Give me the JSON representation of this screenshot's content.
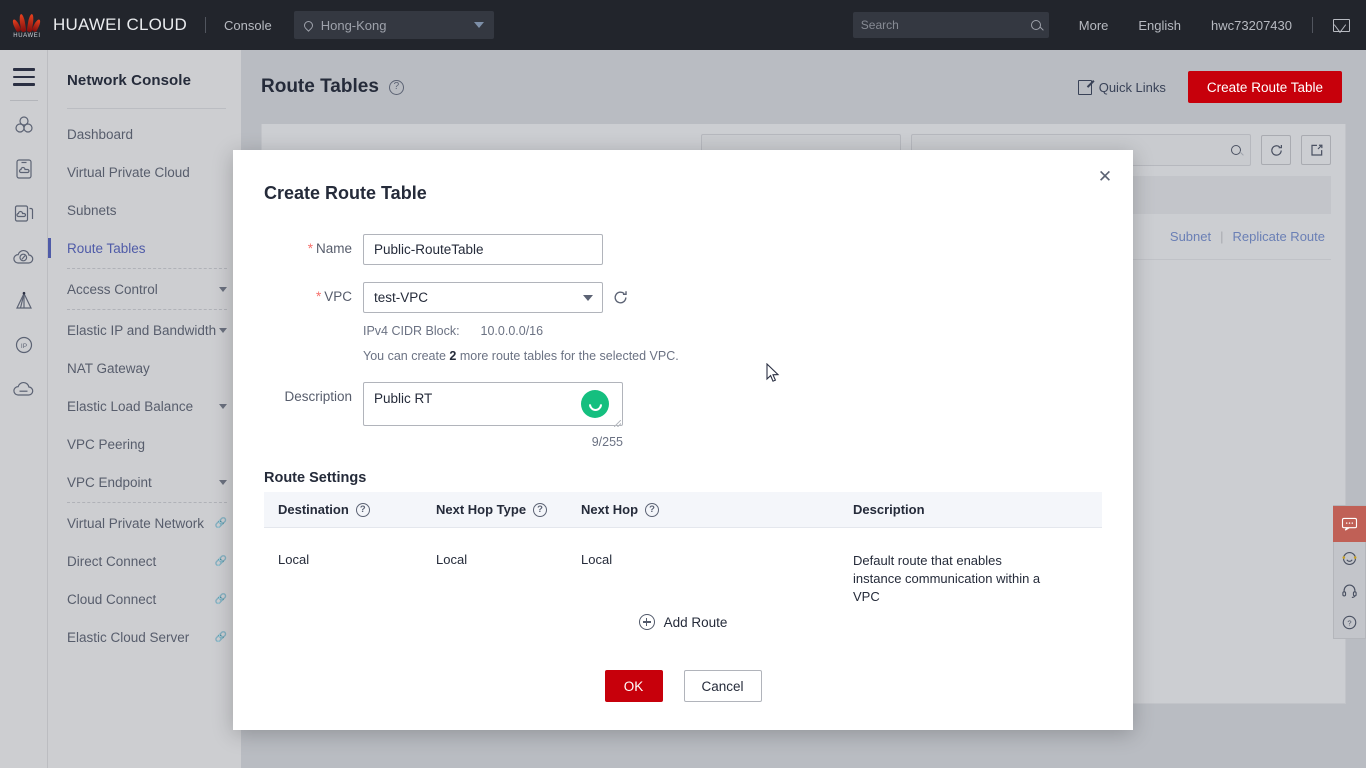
{
  "topbar": {
    "brand": "HUAWEI CLOUD",
    "brand_sub": "HUAWEI",
    "console_label": "Console",
    "region": "Hong-Kong",
    "region_icon": "location-pin-icon",
    "search_placeholder": "Search",
    "search_icon": "search-icon",
    "more_label": "More",
    "language_label": "English",
    "account_label": "hwc73207430",
    "mail_icon": "envelope-icon"
  },
  "rail": {
    "menu_icon": "hamburger-menu-icon",
    "icons": [
      "service-group-icon",
      "cloud-document-icon",
      "cloud-copy-icon",
      "cloud-speed-icon",
      "cdn-pyramid-icon",
      "elastic-ip-icon",
      "cloud-nat-icon"
    ]
  },
  "sidebar": {
    "title": "Network Console",
    "items": [
      {
        "label": "Dashboard",
        "expandable": false,
        "external": false,
        "active": false
      },
      {
        "label": "Virtual Private Cloud",
        "expandable": false,
        "external": false,
        "active": false
      },
      {
        "label": "Subnets",
        "expandable": false,
        "external": false,
        "active": false
      },
      {
        "label": "Route Tables",
        "expandable": false,
        "external": false,
        "active": true
      },
      {
        "label": "Access Control",
        "expandable": true,
        "external": false,
        "active": false
      },
      {
        "label": "Elastic IP and Bandwidth",
        "expandable": true,
        "external": false,
        "active": false
      },
      {
        "label": "NAT Gateway",
        "expandable": false,
        "external": false,
        "active": false
      },
      {
        "label": "Elastic Load Balance",
        "expandable": true,
        "external": false,
        "active": false
      },
      {
        "label": "VPC Peering",
        "expandable": false,
        "external": false,
        "active": false
      },
      {
        "label": "VPC Endpoint",
        "expandable": true,
        "external": false,
        "active": false
      },
      {
        "label": "Virtual Private Network",
        "expandable": false,
        "external": true,
        "active": false
      },
      {
        "label": "Direct Connect",
        "expandable": false,
        "external": true,
        "active": false
      },
      {
        "label": "Cloud Connect",
        "expandable": false,
        "external": true,
        "active": false
      },
      {
        "label": "Elastic Cloud Server",
        "expandable": false,
        "external": true,
        "active": false
      }
    ]
  },
  "page": {
    "title": "Route Tables",
    "help_icon": "question-mark-icon",
    "quick_links": "Quick Links",
    "quick_links_icon": "quick-links-icon",
    "create_button": "Create Route Table",
    "row_links": [
      "Subnet",
      "Replicate Route"
    ],
    "search_icon": "search-icon",
    "refresh_icon": "refresh-icon",
    "export_icon": "export-icon"
  },
  "float_rail": {
    "items": [
      "chat-bubble-icon",
      "smiley-feedback-icon",
      "headset-support-icon",
      "question-help-icon"
    ]
  },
  "modal": {
    "title": "Create Route Table",
    "close_icon": "close-icon",
    "name": {
      "label": "Name",
      "required_mark": "*",
      "value": "Public-RouteTable"
    },
    "vpc": {
      "label": "VPC",
      "required_mark": "*",
      "value": "test-VPC",
      "caret_icon": "chevron-down-icon",
      "refresh_icon": "refresh-icon",
      "cidr_label": "IPv4 CIDR Block:",
      "cidr_value": "10.0.0.0/16",
      "quota_prefix": "You can create",
      "quota_count": "2",
      "quota_suffix": "more route tables for the selected VPC."
    },
    "description": {
      "label": "Description",
      "value": "Public RT",
      "counter": "9/255",
      "ime_icon": "ime-indicator-icon"
    },
    "route_settings": {
      "section_title": "Route Settings",
      "columns": [
        {
          "label": "Destination",
          "help": true
        },
        {
          "label": "Next Hop Type",
          "help": true
        },
        {
          "label": "Next Hop",
          "help": true
        },
        {
          "label": "Description",
          "help": false
        }
      ],
      "rows": [
        {
          "destination": "Local",
          "next_hop_type": "Local",
          "next_hop": "Local",
          "description": "Default route that enables instance communication within a VPC"
        }
      ],
      "add_route_label": "Add Route",
      "add_route_icon": "plus-circle-icon"
    },
    "ok_label": "OK",
    "cancel_label": "Cancel"
  },
  "colors": {
    "brand_red": "#c7000b",
    "topbar_bg": "#22252c",
    "accent_blue": "#4f5ba8",
    "required_red": "#f66f6a",
    "ime_green": "#15bf7f"
  }
}
